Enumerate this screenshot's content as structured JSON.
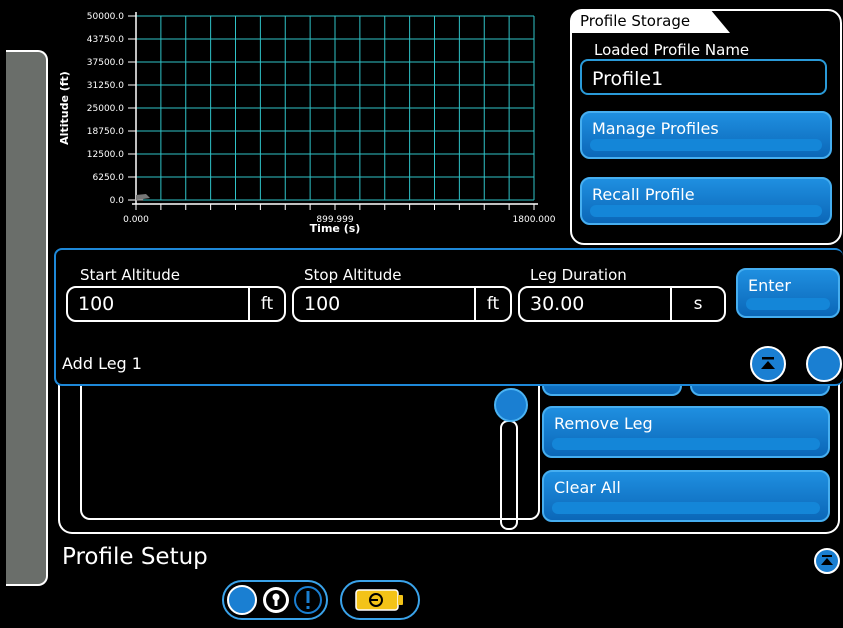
{
  "chart_data": {
    "type": "area",
    "ylabel": "Altitude (ft)",
    "xlabel": "Time (s)",
    "y_ticks": [
      "50000.0",
      "43750.0",
      "37500.0",
      "31250.0",
      "25000.0",
      "18750.0",
      "12500.0",
      "6250.0",
      "0.0"
    ],
    "x_ticks": [
      "0.000",
      "899.999",
      "1800.000"
    ],
    "ylim": [
      0,
      50000
    ],
    "xlim": [
      0,
      1800
    ],
    "grid": true,
    "series": [
      {
        "x": [
          0,
          30,
          30
        ],
        "y": [
          100,
          100,
          0
        ]
      }
    ]
  },
  "storage": {
    "tab_title": "Profile Storage",
    "loaded_label": "Loaded Profile Name",
    "loaded_value": "Profile1",
    "manage_label": "Manage Profiles",
    "recall_label": "Recall Profile"
  },
  "add_leg": {
    "start_label": "Start Altitude",
    "start_value": "100",
    "start_unit": "ft",
    "stop_label": "Stop Altitude",
    "stop_value": "100",
    "stop_unit": "ft",
    "duration_label": "Leg Duration",
    "duration_value": "30.00",
    "duration_unit": "s",
    "enter_label": "Enter",
    "title": "Add Leg 1"
  },
  "lower": {
    "remove_label": "Remove Leg",
    "clear_label": "Clear All"
  },
  "footer": {
    "title": "Profile Setup"
  },
  "colors": {
    "accent": "#1a7fd2",
    "grid": "#2fc3c8"
  },
  "icons": {
    "lock": "lock-icon",
    "alert": "exclamation-icon",
    "battery": "battery-icon",
    "collapse": "collapse-up-icon"
  }
}
